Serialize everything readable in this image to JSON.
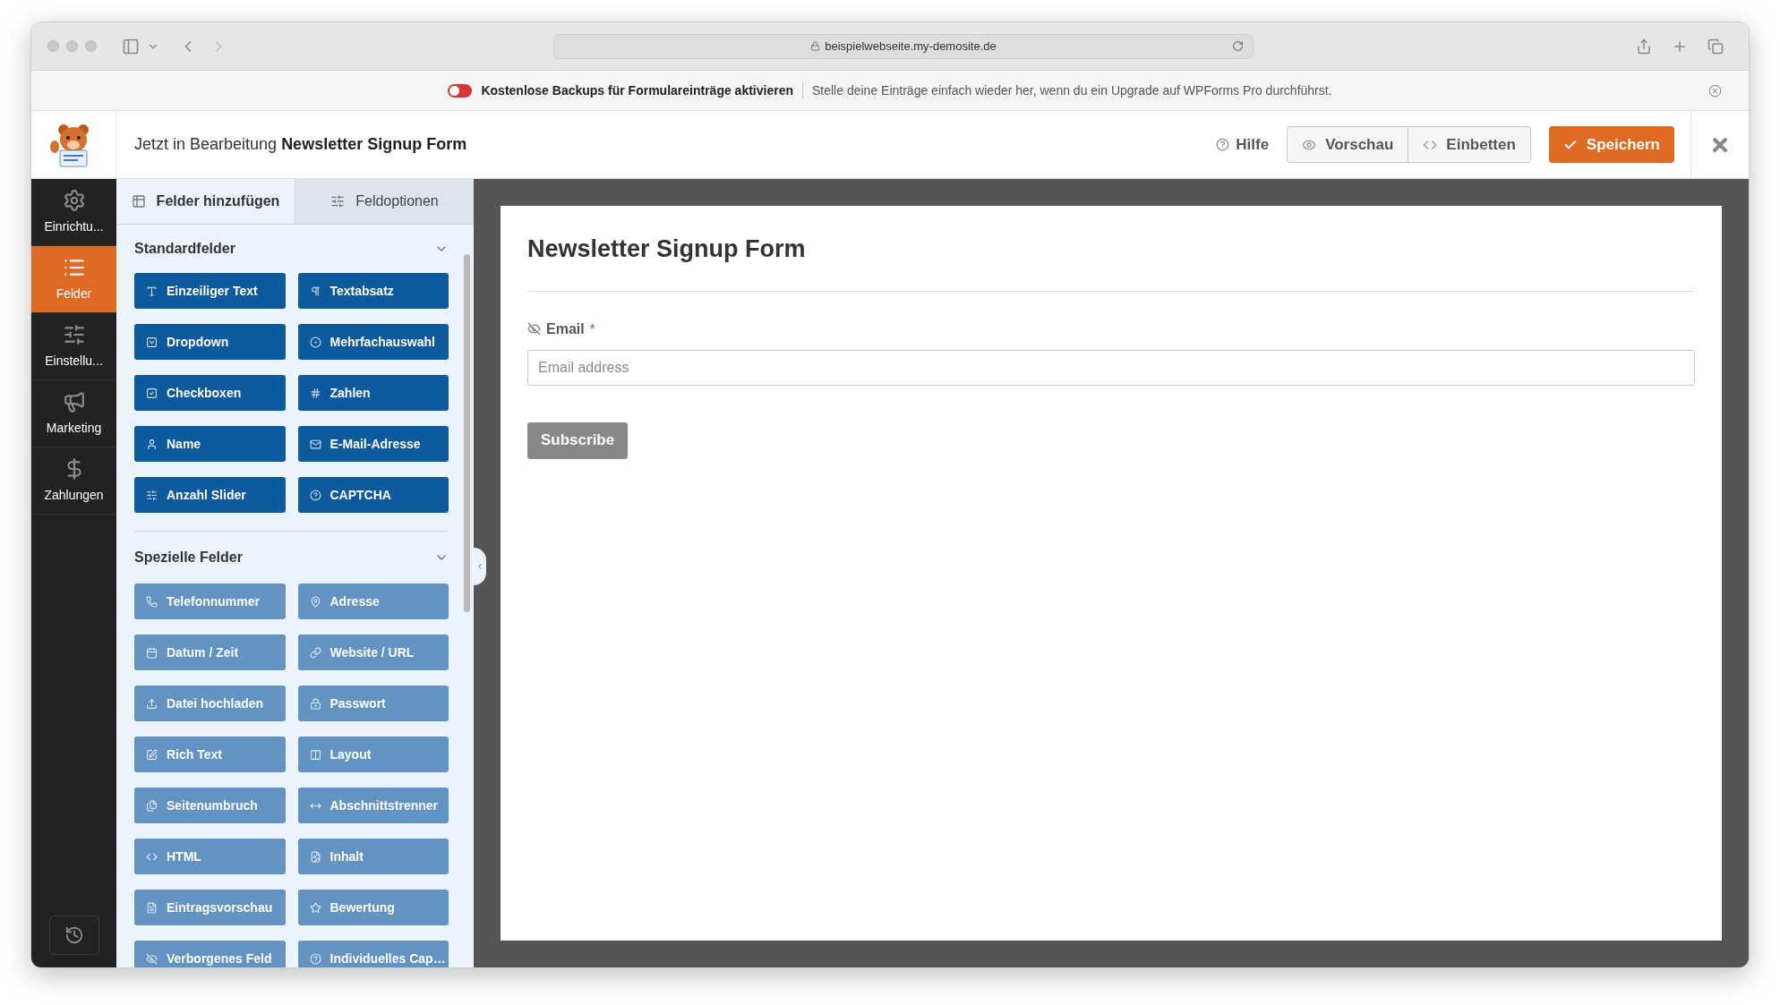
{
  "browser": {
    "url": "beispielwebseite.my-demosite.de"
  },
  "notice": {
    "toggle_on": false,
    "title": "Kostenlose Backups für Formulareinträge aktivieren",
    "message": "Stelle deine Einträge einfach wieder her, wenn du ein Upgrade auf WPForms Pro durchführst."
  },
  "header": {
    "prefix": "Jetzt in Bearbeitung",
    "form_name": "Newsletter Signup Form",
    "help": "Hilfe",
    "buttons": [
      "Vorschau",
      "Einbetten"
    ],
    "save": "Speichern"
  },
  "sidebar": {
    "items": [
      {
        "label": "Einrichtu...",
        "selected": false
      },
      {
        "label": "Felder",
        "selected": true
      },
      {
        "label": "Einstellu...",
        "selected": false
      },
      {
        "label": "Marketing",
        "selected": false
      },
      {
        "label": "Zahlungen",
        "selected": false
      }
    ]
  },
  "panel": {
    "tabs": [
      {
        "label": "Felder hinzufügen",
        "selected": true
      },
      {
        "label": "Feldoptionen",
        "selected": false
      }
    ],
    "sections": [
      {
        "title": "Standardfelder",
        "kind": "standard",
        "expanded": true,
        "fields": [
          "Einzeiliger Text",
          "Textabsatz",
          "Dropdown",
          "Mehrfachauswahl",
          "Checkboxen",
          "Zahlen",
          "Name",
          "E-Mail-Adresse",
          "Anzahl Slider",
          "CAPTCHA"
        ]
      },
      {
        "title": "Spezielle Felder",
        "kind": "special",
        "expanded": true,
        "fields": [
          "Telefonnummer",
          "Adresse",
          "Datum / Zeit",
          "Website / URL",
          "Datei hochladen",
          "Passwort",
          "Rich Text",
          "Layout",
          "Seitenumbruch",
          "Abschnittstrenner",
          "HTML",
          "Inhalt",
          "Eintragsvorschau",
          "Bewertung",
          "Verborgenes Feld",
          "Individuelles Cap…"
        ]
      }
    ]
  },
  "form": {
    "title": "Newsletter Signup Form",
    "fields": [
      {
        "label": "Email",
        "required": true,
        "required_mark": "*",
        "placeholder": "Email address"
      }
    ],
    "submit": "Subscribe"
  }
}
